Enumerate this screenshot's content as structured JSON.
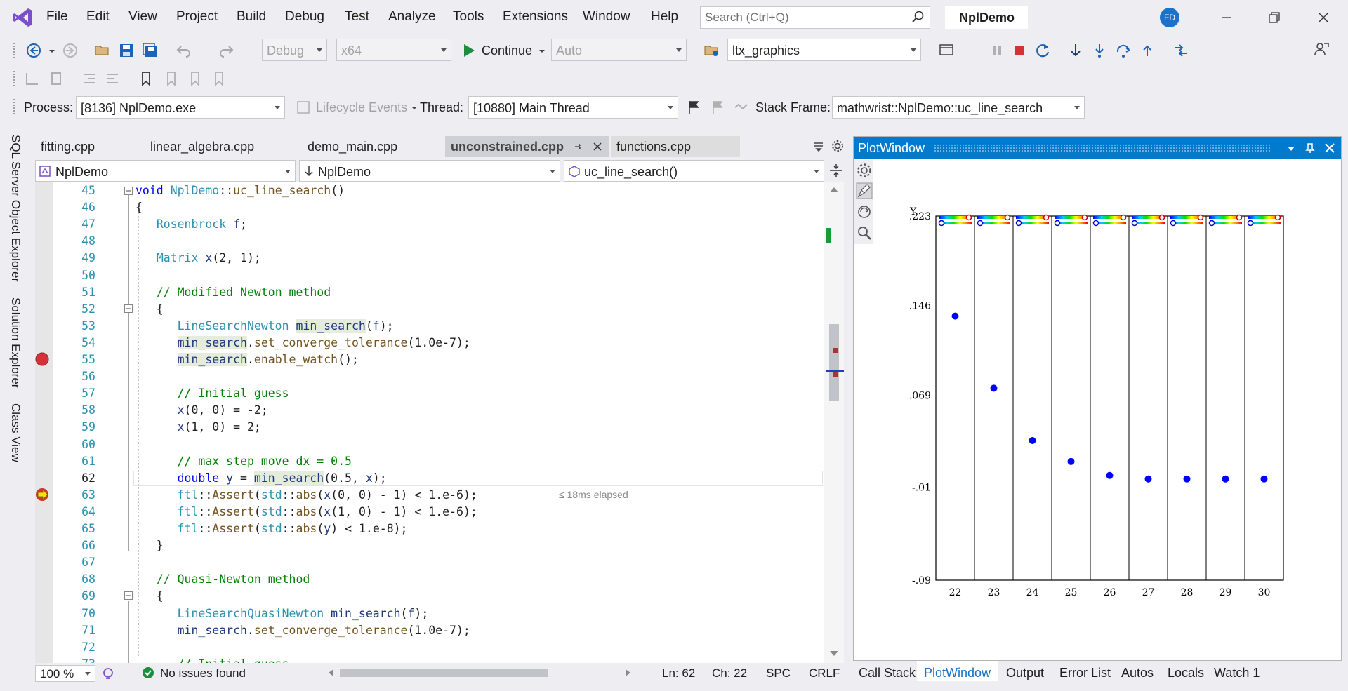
{
  "menu": [
    "File",
    "Edit",
    "View",
    "Project",
    "Build",
    "Debug",
    "Test",
    "Analyze",
    "Tools",
    "Extensions",
    "Window",
    "Help"
  ],
  "search": {
    "placeholder": "Search (Ctrl+Q)"
  },
  "solution_name": "NplDemo",
  "user_initials": "FD",
  "toolbar": {
    "config": "Debug",
    "platform": "x64",
    "continue_label": "Continue",
    "auto": "Auto",
    "startup_item": "ltx_graphics"
  },
  "debug_location": {
    "process_label": "Process:",
    "process": "[8136] NplDemo.exe",
    "lifecycle": "Lifecycle Events",
    "thread_label": "Thread:",
    "thread": "[10880] Main Thread",
    "stackframe_label": "Stack Frame:",
    "stackframe": "mathwrist::NplDemo::uc_line_search"
  },
  "side_tabs": [
    "SQL Server Object Explorer",
    "Solution Explorer",
    "Class View"
  ],
  "tabs": [
    "fitting.cpp",
    "linear_algebra.cpp",
    "demo_main.cpp",
    "unconstrained.cpp",
    "functions.cpp"
  ],
  "nav": {
    "scope": "NplDemo",
    "member_scope": "NplDemo",
    "function": "uc_line_search()"
  },
  "elapsed": "≤ 18ms elapsed",
  "status": {
    "zoom": "100 %",
    "issues": "No issues found",
    "line": "Ln: 62",
    "col": "Ch: 22",
    "spc": "SPC",
    "crlf": "CRLF"
  },
  "plot_window": {
    "title": "PlotWindow"
  },
  "chart_data": {
    "type": "scatter",
    "ylabel": "Y",
    "x": [
      22,
      23,
      24,
      25,
      26,
      27,
      28,
      29,
      30
    ],
    "y": [
      0.137,
      0.075,
      0.03,
      0.012,
      0.0,
      -0.003,
      -0.003,
      -0.003,
      -0.003
    ],
    "y_ticks": [
      ".223",
      ".146",
      ".069",
      "-.01",
      "-.09"
    ],
    "y_tick_values": [
      0.223,
      0.146,
      0.069,
      -0.01,
      -0.09
    ],
    "ylim": [
      -0.09,
      0.223
    ],
    "x_ticks": [
      "22",
      "23",
      "24",
      "25",
      "26",
      "27",
      "28",
      "29",
      "30"
    ],
    "color": "#0000ff"
  },
  "bottom_tabs": [
    "Call Stack",
    "PlotWindow",
    "Output",
    "Error List",
    "Autos",
    "Locals",
    "Watch 1"
  ]
}
